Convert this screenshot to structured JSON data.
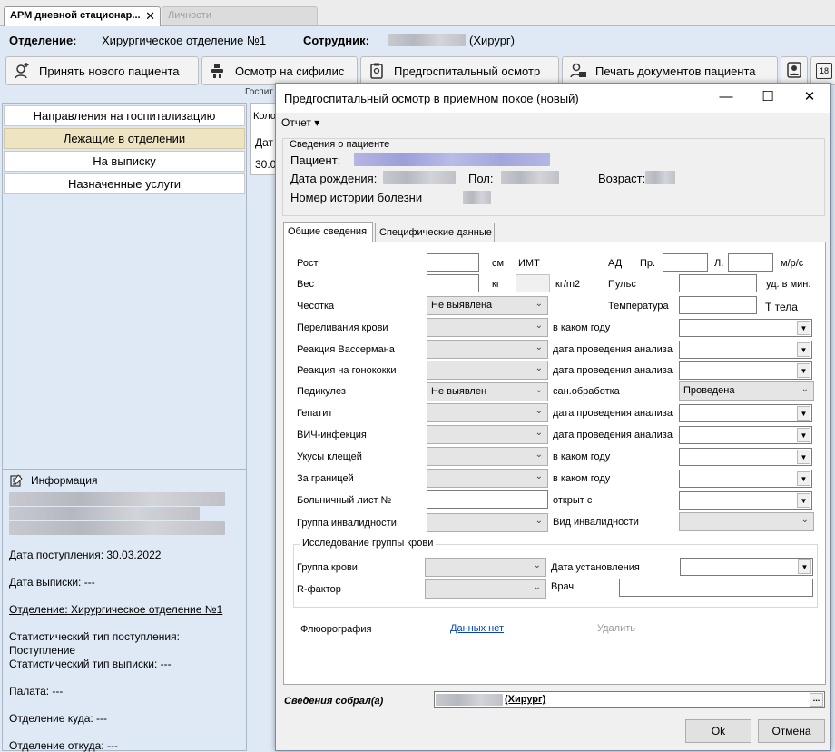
{
  "tabs": [
    {
      "label": "АРМ дневной стационар...",
      "close": "✕"
    },
    {
      "label": "Личности"
    }
  ],
  "header": {
    "dept_label": "Отделение:",
    "dept_value": "Хирургическое отделение №1",
    "emp_label": "Сотрудник:",
    "emp_role": "(Хирург)"
  },
  "toolbar": {
    "new_patient": "Принять нового пациента",
    "syphilis": "Осмотр на сифилис",
    "prehosp": "Предгоспитальный осмотр",
    "print_docs": "Печать документов пациента",
    "calendar_day": "18"
  },
  "behind": {
    "gospit": "Госпит",
    "col": "Коло",
    "dat": "Дат",
    "val": "30.0"
  },
  "left_nav": [
    {
      "label": "Направления на госпитализацию",
      "selected": false
    },
    {
      "label": "Лежащие в отделении",
      "selected": true
    },
    {
      "label": "На выписку",
      "selected": false
    },
    {
      "label": "Назначенные услуги",
      "selected": false
    }
  ],
  "info": {
    "title": "Информация",
    "admit": "Дата поступления: 30.03.2022",
    "discharge": "Дата выписки: ---",
    "dept": "Отделение: Хирургическое отделение №1",
    "stat_in_label": "Статистический тип поступления:",
    "stat_in_value": "Поступление",
    "stat_out": "Статистический тип выписки: ---",
    "ward": "Палата: ---",
    "dept_to": "Отделение куда: ---",
    "dept_from": "Отделение откуда: ---"
  },
  "dialog": {
    "title": "Предгоспитальный осмотр в приемном покое (новый)",
    "menu_report": "Отчет ▾",
    "patient_group": "Сведения о пациенте",
    "patient_label": "Пациент:",
    "dob_label": "Дата рождения:",
    "sex_label": "Пол:",
    "age_label": "Возраст:",
    "history_label": "Номер истории болезни",
    "tab_general": "Общие сведения",
    "tab_specific": "Специфические данные",
    "form": {
      "height": "Рост",
      "cm": "см",
      "bmi": "ИМТ",
      "bp": "АД",
      "bp_r": "Пр.",
      "bp_l": "Л.",
      "bp_unit": "м/р/с",
      "weight": "Вес",
      "kg": "кг",
      "kgm2": "кг/m2",
      "pulse": "Пульс",
      "pulse_unit": "уд. в мин.",
      "scabies": "Чесотка",
      "scabies_val": "Не выявлена",
      "temp": "Температура",
      "temp_unit": "Т тела",
      "transfusion": "Переливания крови",
      "which_year": "в каком году",
      "wasserman": "Реакция Вассермана",
      "analysis_date": "дата проведения анализа",
      "gonococcus": "Реакция на гонококки",
      "pediculosis": "Педикулез",
      "pediculosis_val": "Не выявлен",
      "sanit": "сан.обработка",
      "sanit_val": "Проведена",
      "hepatitis": "Гепатит",
      "hiv": "ВИЧ-инфекция",
      "ticks": "Укусы клещей",
      "abroad": "За границей",
      "sick_leave": "Больничный лист №",
      "opened_from": "открыт с",
      "disability_group": "Группа инвалидности",
      "disability_type": "Вид инвалидности",
      "blood_group_title": "Исследование группы крови",
      "blood_group": "Группа крови",
      "est_date": "Дата установления",
      "rh": "R-фактор",
      "doctor": "Врач",
      "fluoro": "Флюорография",
      "no_data": "Данных нет",
      "delete": "Удалить"
    },
    "collected_by": "Сведения собрал(а)",
    "collected_role": "(Хирург)",
    "ellipsis": "...",
    "ok": "Ok",
    "cancel": "Отмена"
  }
}
